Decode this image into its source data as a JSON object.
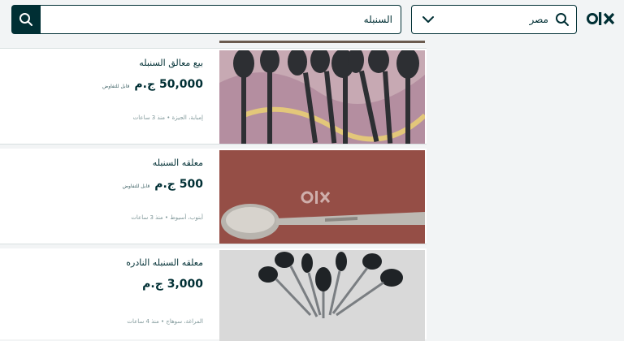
{
  "header": {
    "search_value": "السنبله",
    "location_value": "مصر",
    "logo_text": "olx",
    "icons": {
      "search": "search-icon",
      "location": "search-icon",
      "chevron": "chevron-down-icon"
    }
  },
  "listings": [
    {
      "title": "بيع معالق السنبله",
      "price": "50,000 ج.م",
      "negotiable": "قابل للتفاوض",
      "location": "إمبابة، الجيزة",
      "time": "منذ 3 ساعات"
    },
    {
      "title": "معلقه السنبله",
      "price": "500 ج.م",
      "negotiable": "قابل للتفاوض",
      "location": "أبنوب، أسيوط",
      "time": "منذ 3 ساعات"
    },
    {
      "title": "معلقه السنبله النادره",
      "price": "3,000 ج.م",
      "negotiable": "",
      "location": "المراغة، سوهاج",
      "time": "منذ 4 ساعات"
    }
  ],
  "colors": {
    "brand": "#002f34",
    "muted": "#7f9799",
    "bg": "#f2f4f5"
  }
}
